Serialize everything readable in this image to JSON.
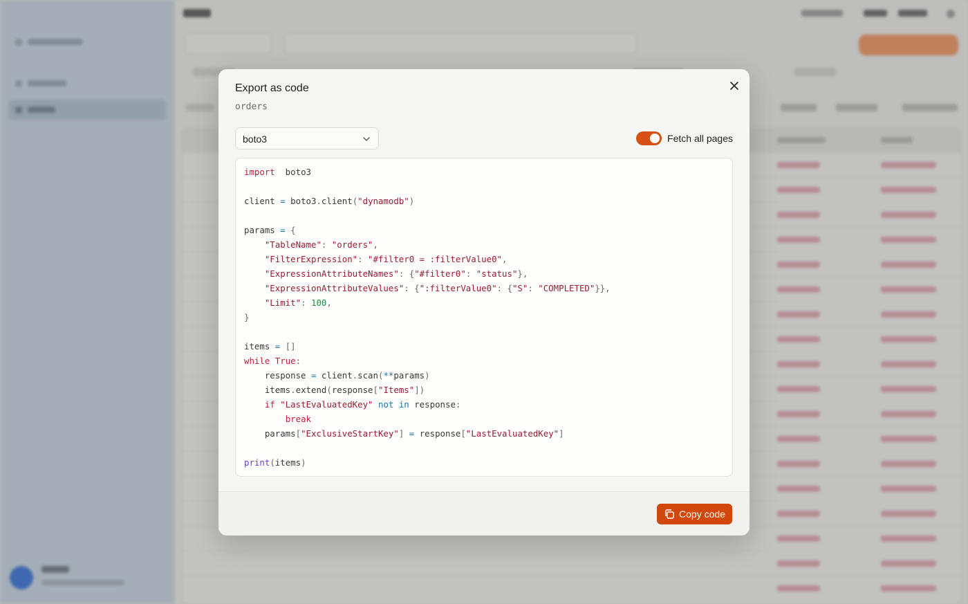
{
  "modal": {
    "title": "Export as code",
    "subtitle": "orders",
    "language_select": {
      "value": "boto3"
    },
    "fetch_all_pages": {
      "label": "Fetch all pages",
      "enabled": true
    },
    "copy_button_label": "Copy code",
    "code_lines": [
      [
        [
          "kw",
          "import"
        ],
        [
          "",
          "  boto3"
        ]
      ],
      [],
      [
        [
          "",
          "client "
        ],
        [
          "op",
          "="
        ],
        [
          "",
          " boto3"
        ],
        [
          "pn",
          "."
        ],
        [
          "",
          "client"
        ],
        [
          "pn",
          "("
        ],
        [
          "str",
          "\"dynamodb\""
        ],
        [
          "pn",
          ")"
        ]
      ],
      [],
      [
        [
          "",
          "params "
        ],
        [
          "op",
          "="
        ],
        [
          "pn",
          " {"
        ]
      ],
      [
        [
          "",
          "    "
        ],
        [
          "str",
          "\"TableName\""
        ],
        [
          "pn",
          ": "
        ],
        [
          "str",
          "\"orders\""
        ],
        [
          "pn",
          ","
        ]
      ],
      [
        [
          "",
          "    "
        ],
        [
          "str",
          "\"FilterExpression\""
        ],
        [
          "pn",
          ": "
        ],
        [
          "str",
          "\"#filter0 = :filterValue0\""
        ],
        [
          "pn",
          ","
        ]
      ],
      [
        [
          "",
          "    "
        ],
        [
          "str",
          "\"ExpressionAttributeNames\""
        ],
        [
          "pn",
          ": {"
        ],
        [
          "str",
          "\"#filter0\""
        ],
        [
          "pn",
          ": "
        ],
        [
          "str",
          "\"status\""
        ],
        [
          "pn",
          "},"
        ]
      ],
      [
        [
          "",
          "    "
        ],
        [
          "str",
          "\"ExpressionAttributeValues\""
        ],
        [
          "pn",
          ": {"
        ],
        [
          "str",
          "\":filterValue0\""
        ],
        [
          "pn",
          ": {"
        ],
        [
          "str",
          "\"S\""
        ],
        [
          "pn",
          ": "
        ],
        [
          "str",
          "\"COMPLETED\""
        ],
        [
          "pn",
          "}},"
        ]
      ],
      [
        [
          "",
          "    "
        ],
        [
          "str",
          "\"Limit\""
        ],
        [
          "pn",
          ": "
        ],
        [
          "num",
          "100"
        ],
        [
          "pn",
          ","
        ]
      ],
      [
        [
          "pn",
          "}"
        ]
      ],
      [],
      [
        [
          "",
          "items "
        ],
        [
          "op",
          "="
        ],
        [
          "pn",
          " []"
        ]
      ],
      [
        [
          "kw",
          "while"
        ],
        [
          "",
          " "
        ],
        [
          "kw",
          "True"
        ],
        [
          "pn",
          ":"
        ]
      ],
      [
        [
          "",
          "    response "
        ],
        [
          "op",
          "="
        ],
        [
          "",
          " client"
        ],
        [
          "pn",
          "."
        ],
        [
          "",
          "scan"
        ],
        [
          "pn",
          "("
        ],
        [
          "op",
          "**"
        ],
        [
          "",
          "params"
        ],
        [
          "pn",
          ")"
        ]
      ],
      [
        [
          "",
          "    items"
        ],
        [
          "pn",
          "."
        ],
        [
          "",
          "extend"
        ],
        [
          "pn",
          "("
        ],
        [
          "",
          "response"
        ],
        [
          "pn",
          "["
        ],
        [
          "str",
          "\"Items\""
        ],
        [
          "pn",
          "])"
        ]
      ],
      [
        [
          "",
          "    "
        ],
        [
          "kw",
          "if"
        ],
        [
          "",
          " "
        ],
        [
          "str",
          "\"LastEvaluatedKey\""
        ],
        [
          "",
          " "
        ],
        [
          "op",
          "not"
        ],
        [
          "",
          " "
        ],
        [
          "op",
          "in"
        ],
        [
          "",
          " response"
        ],
        [
          "pn",
          ":"
        ]
      ],
      [
        [
          "",
          "        "
        ],
        [
          "kw",
          "break"
        ]
      ],
      [
        [
          "",
          "    params"
        ],
        [
          "pn",
          "["
        ],
        [
          "str",
          "\"ExclusiveStartKey\""
        ],
        [
          "pn",
          "]"
        ],
        [
          "",
          " "
        ],
        [
          "op",
          "="
        ],
        [
          "",
          " response"
        ],
        [
          "pn",
          "["
        ],
        [
          "str",
          "\"LastEvaluatedKey\""
        ],
        [
          "pn",
          "]"
        ]
      ],
      [],
      [
        [
          "fn",
          "print"
        ],
        [
          "pn",
          "("
        ],
        [
          "",
          "items"
        ],
        [
          "pn",
          ")"
        ]
      ]
    ]
  },
  "colors": {
    "accent": "#d2470b",
    "toggle_on": "#d64f13",
    "code_keyword": "#c0203d",
    "code_string": "#9a1b34",
    "code_number": "#1f8e3d",
    "code_function": "#6f42c1"
  }
}
